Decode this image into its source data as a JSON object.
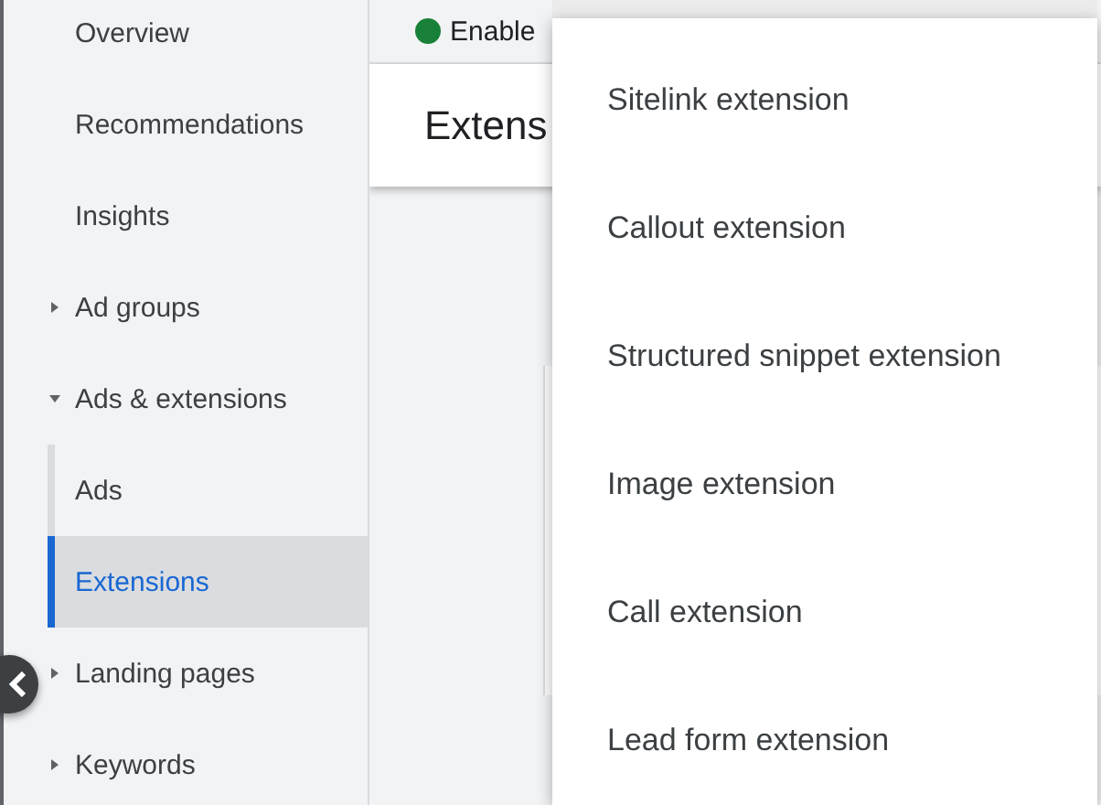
{
  "sidebar": {
    "items": [
      {
        "label": "Overview",
        "selected": false
      },
      {
        "label": "Recommendations",
        "selected": false
      },
      {
        "label": "Insights",
        "selected": false
      },
      {
        "label": "Ad groups",
        "selected": false,
        "expanded": false
      },
      {
        "label": "Ads & extensions",
        "selected": false,
        "expanded": true,
        "children": [
          {
            "label": "Ads",
            "selected": false
          },
          {
            "label": "Extensions",
            "selected": true
          }
        ]
      },
      {
        "label": "Landing pages",
        "selected": false,
        "expanded": false
      },
      {
        "label": "Keywords",
        "selected": false,
        "expanded": false
      }
    ]
  },
  "status": {
    "label": "Enable",
    "color": "#188038"
  },
  "page_title": "Extens",
  "menu": {
    "items": [
      "Sitelink extension",
      "Callout extension",
      "Structured snippet extension",
      "Image extension",
      "Call extension",
      "Lead form extension"
    ]
  }
}
